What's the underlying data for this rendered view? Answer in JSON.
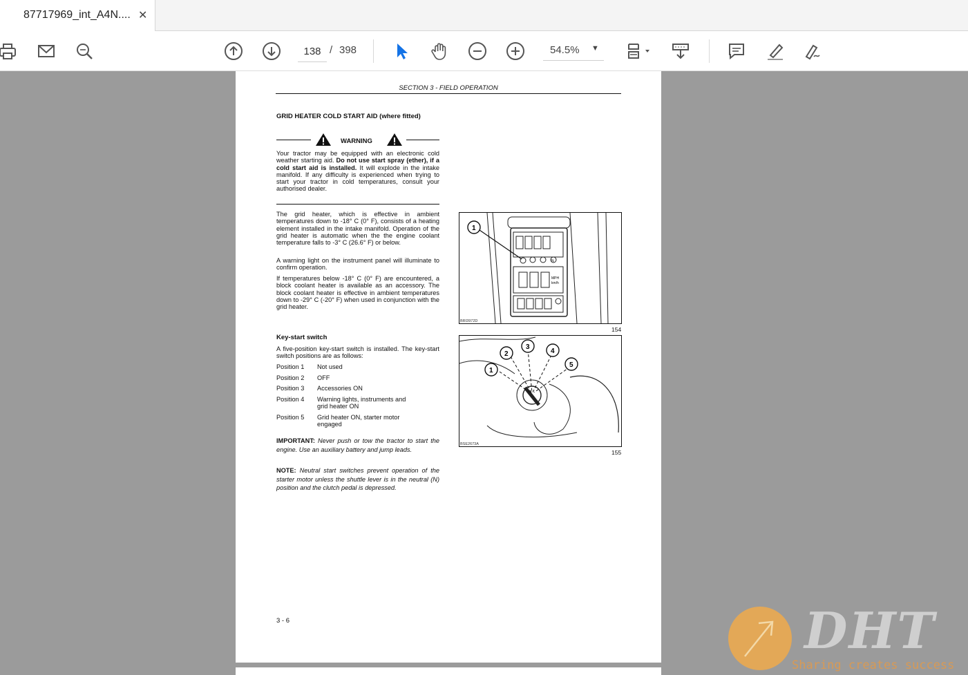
{
  "tab": {
    "title": "87717969_int_A4N....",
    "close_glyph": "✕"
  },
  "toolbar": {
    "left_icons": [
      "print-icon",
      "email-icon",
      "zoom-search-icon"
    ],
    "page_current": "138",
    "page_separator": "/",
    "page_total": "398",
    "zoom_value": "54.5%",
    "right_icons": [
      "comment-icon",
      "highlight-pen-icon",
      "sign-icon"
    ],
    "accent_color": "#1473e6"
  },
  "document": {
    "header": "SECTION 3 - FIELD OPERATION",
    "heading": "GRID HEATER COLD START AID (where fitted)",
    "warning_label": "WARNING",
    "warning_text_1": "Your tractor may be equipped with an electronic cold weather starting aid. ",
    "warning_text_bold": "Do not use start spray (ether), if a cold start aid is installed.",
    "warning_text_2": " It will explode in the intake manifold. If any difficulty is experienced when trying to start your tractor in cold temperatures, consult your authorised dealer.",
    "para1": "The grid heater, which is effective in ambient temperatures down to -18° C (0° F), consists of a heating element installed in the intake manifold. Operation of the grid heater is automatic when the the engine coolant temperature falls to -3° C (26.6° F) or below.",
    "para2": "A warning light on the instrument panel will illuminate to confirm operation.",
    "para3": "If temperatures below -18° C (0° F) are encountered, a block coolant heater is available as an accessory. The block coolant heater is effective in ambient temperatures down to -29° C (-20° F) when used in conjunction with the grid heater.",
    "keystart_heading": "Key-start switch",
    "keystart_intro": "A five-position key-start switch is installed. The key-start switch positions are as follows:",
    "positions": [
      {
        "label": "Position 1",
        "desc": "Not used"
      },
      {
        "label": "Position 2",
        "desc": "OFF"
      },
      {
        "label": "Position 3",
        "desc": "Accessories ON"
      },
      {
        "label": "Position 4",
        "desc": "Warning lights, instruments and grid heater ON"
      },
      {
        "label": "Position 5",
        "desc": "Grid heater ON, starter motor engaged"
      }
    ],
    "important_label": "IMPORTANT:",
    "important_text": " Never push or tow the tractor to start the engine. Use an auxiliary battery and jump leads.",
    "note_label": "NOTE:",
    "note_text": " Neutral start switches prevent operation of the starter motor unless the shuttle lever is in the neutral (N) position and the clutch pedal is depressed.",
    "figure1_number": "154",
    "figure1_code": "BRI3972D",
    "figure1_callout": "1",
    "figure1_panel_mph": "MPH",
    "figure1_panel_kmh": "km/h",
    "figure1_panel_n": "N",
    "figure2_number": "155",
    "figure2_code": "BSE2673A",
    "figure2_callouts": [
      "1",
      "2",
      "3",
      "4",
      "5"
    ],
    "page_number": "3 - 6"
  },
  "watermark": {
    "text": "DHT",
    "subtitle": "Sharing creates success"
  }
}
